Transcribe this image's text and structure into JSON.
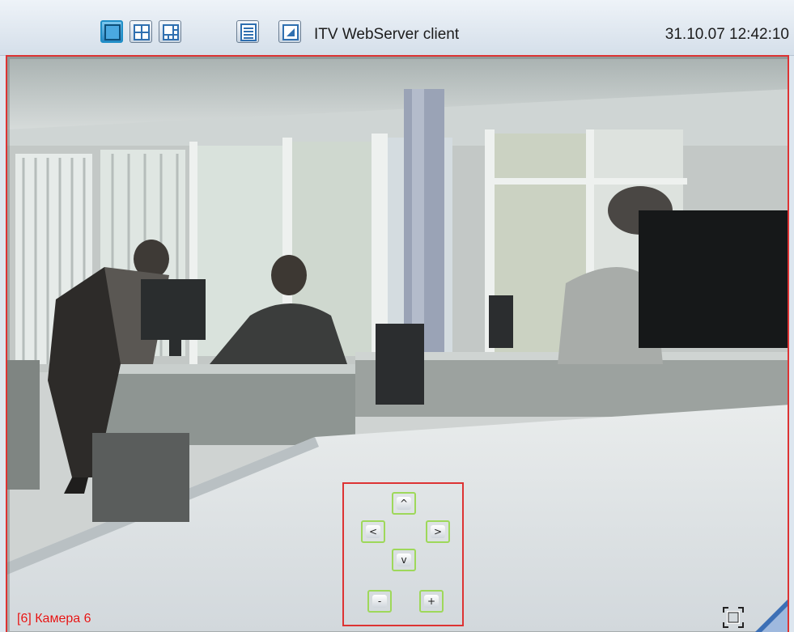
{
  "toolbar": {
    "layout_buttons": [
      {
        "name": "layout-1x1",
        "active": true
      },
      {
        "name": "layout-2x2",
        "active": false
      },
      {
        "name": "layout-3x3",
        "active": false
      }
    ],
    "list_button_icon": "list-icon",
    "window_button_icon": "window-icon",
    "app_title": "ITV WebServer client",
    "datetime": "31.10.07 12:42:10"
  },
  "video": {
    "camera_label": "[6] Камера 6",
    "fullscreen_icon": "fullscreen-icon"
  },
  "ptz": {
    "up": "^",
    "left": "<",
    "right": ">",
    "down": "v",
    "zoom_out": "-",
    "zoom_in": "+"
  },
  "colors": {
    "frame_border": "#dd3333",
    "ptz_button_border": "#9ed85a",
    "camera_label": "#e01010",
    "active_button": "#1f8ec7"
  }
}
